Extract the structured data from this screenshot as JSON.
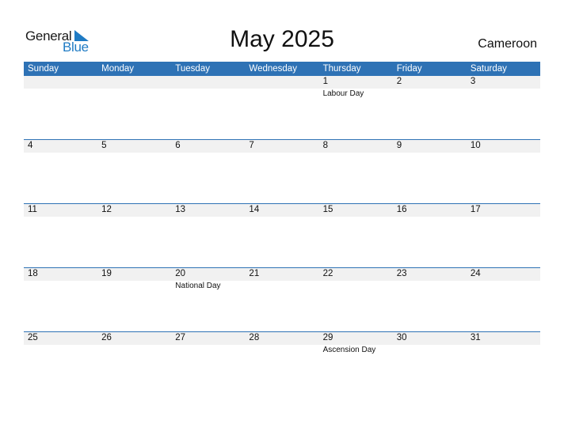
{
  "logo": {
    "word1": "General",
    "word2": "Blue",
    "icon": "triangle-flag-icon",
    "accent": "#1f7bc4"
  },
  "title": "May 2025",
  "country": "Cameroon",
  "colors": {
    "header_bg": "#2e72b5",
    "band_bg": "#f1f1f1"
  },
  "weekdays": [
    "Sunday",
    "Monday",
    "Tuesday",
    "Wednesday",
    "Thursday",
    "Friday",
    "Saturday"
  ],
  "weeks": [
    [
      {
        "day": "",
        "holiday": ""
      },
      {
        "day": "",
        "holiday": ""
      },
      {
        "day": "",
        "holiday": ""
      },
      {
        "day": "",
        "holiday": ""
      },
      {
        "day": "1",
        "holiday": "Labour Day"
      },
      {
        "day": "2",
        "holiday": ""
      },
      {
        "day": "3",
        "holiday": ""
      }
    ],
    [
      {
        "day": "4",
        "holiday": ""
      },
      {
        "day": "5",
        "holiday": ""
      },
      {
        "day": "6",
        "holiday": ""
      },
      {
        "day": "7",
        "holiday": ""
      },
      {
        "day": "8",
        "holiday": ""
      },
      {
        "day": "9",
        "holiday": ""
      },
      {
        "day": "10",
        "holiday": ""
      }
    ],
    [
      {
        "day": "11",
        "holiday": ""
      },
      {
        "day": "12",
        "holiday": ""
      },
      {
        "day": "13",
        "holiday": ""
      },
      {
        "day": "14",
        "holiday": ""
      },
      {
        "day": "15",
        "holiday": ""
      },
      {
        "day": "16",
        "holiday": ""
      },
      {
        "day": "17",
        "holiday": ""
      }
    ],
    [
      {
        "day": "18",
        "holiday": ""
      },
      {
        "day": "19",
        "holiday": ""
      },
      {
        "day": "20",
        "holiday": "National Day"
      },
      {
        "day": "21",
        "holiday": ""
      },
      {
        "day": "22",
        "holiday": ""
      },
      {
        "day": "23",
        "holiday": ""
      },
      {
        "day": "24",
        "holiday": ""
      }
    ],
    [
      {
        "day": "25",
        "holiday": ""
      },
      {
        "day": "26",
        "holiday": ""
      },
      {
        "day": "27",
        "holiday": ""
      },
      {
        "day": "28",
        "holiday": ""
      },
      {
        "day": "29",
        "holiday": "Ascension Day"
      },
      {
        "day": "30",
        "holiday": ""
      },
      {
        "day": "31",
        "holiday": ""
      }
    ]
  ]
}
